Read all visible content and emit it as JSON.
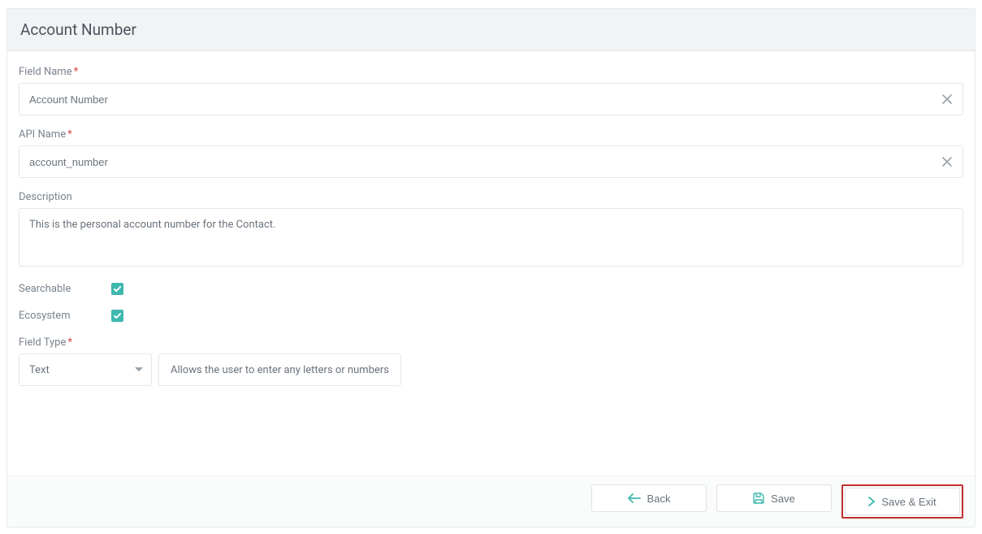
{
  "header": {
    "title": "Account Number"
  },
  "form": {
    "field_name": {
      "label": "Field Name",
      "required_marker": "*",
      "value": "Account Number"
    },
    "api_name": {
      "label": "API Name",
      "required_marker": "*",
      "value": "account_number"
    },
    "description": {
      "label": "Description",
      "value": "This is the personal account number for the Contact."
    },
    "searchable": {
      "label": "Searchable",
      "checked": true
    },
    "ecosystem": {
      "label": "Ecosystem",
      "checked": true
    },
    "field_type": {
      "label": "Field Type",
      "required_marker": "*",
      "selected": "Text",
      "helper": "Allows the user to enter any letters or numbers"
    }
  },
  "footer": {
    "back": "Back",
    "save": "Save",
    "save_exit": "Save & Exit"
  }
}
